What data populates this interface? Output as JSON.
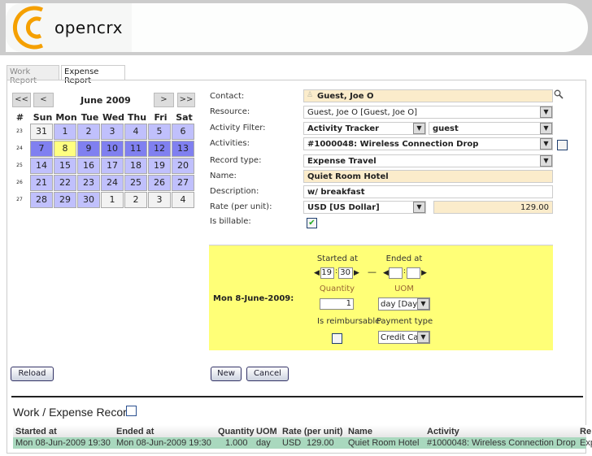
{
  "app": {
    "logo_text": "opencrx",
    "brand_color": "#f5a000"
  },
  "tabs": [
    {
      "label": "Work Report",
      "active": false
    },
    {
      "label": "Expense Report",
      "active": true
    }
  ],
  "calendar": {
    "nav": {
      "prev_year": "<<",
      "prev_month": "<",
      "next_month": ">",
      "next_year": ">>"
    },
    "month_label": "June 2009",
    "week_header": "#",
    "day_headers": [
      "Sun",
      "Mon",
      "Tue",
      "Wed",
      "Thu",
      "Fri",
      "Sat"
    ],
    "weeks": [
      {
        "num": "23",
        "days": [
          "31",
          "1",
          "2",
          "3",
          "4",
          "5",
          "6"
        ]
      },
      {
        "num": "24",
        "days": [
          "7",
          "8",
          "9",
          "10",
          "11",
          "12",
          "13"
        ]
      },
      {
        "num": "25",
        "days": [
          "14",
          "15",
          "16",
          "17",
          "18",
          "19",
          "20"
        ]
      },
      {
        "num": "26",
        "days": [
          "21",
          "22",
          "23",
          "24",
          "25",
          "26",
          "27"
        ]
      },
      {
        "num": "27",
        "days": [
          "28",
          "29",
          "30",
          "1",
          "2",
          "3",
          "4"
        ]
      }
    ],
    "selected_day": "8",
    "colors": {
      "day": "#c0c0fc",
      "selected_week": "#8080f0",
      "today": "#ffff80",
      "other_month": "#f2f2f2"
    }
  },
  "form": {
    "contact": {
      "label": "Contact:",
      "value": "Guest, Joe O"
    },
    "resource": {
      "label": "Resource:",
      "value": "Guest, Joe O [Guest, Joe O]"
    },
    "activity_filter": {
      "label": "Activity Filter:",
      "value": "Activity Tracker",
      "value2": "guest"
    },
    "activities": {
      "label": "Activities:",
      "value": "#1000048: Wireless Connection Drop"
    },
    "record_type": {
      "label": "Record type:",
      "value": "Expense Travel"
    },
    "name": {
      "label": "Name:",
      "value": "Quiet Room Hotel"
    },
    "description": {
      "label": "Description:",
      "value": "w/ breakfast"
    },
    "rate": {
      "label": "Rate (per unit):",
      "currency": "USD [US Dollar]",
      "value": "129.00"
    },
    "billable": {
      "label": "Is billable:",
      "checked": true
    }
  },
  "detail": {
    "date_label": "Mon 8-June-2009:",
    "started_label": "Started at",
    "start_hour": "19",
    "start_min": "30",
    "dash": "—",
    "ended_label": "Ended at",
    "end_hour": "",
    "end_min": "",
    "quantity_label": "Quantity",
    "quantity": "1",
    "uom_label": "UOM",
    "uom": "day [Day]",
    "reimbursable_label": "Is reimbursable",
    "payment_label": "Payment type",
    "payment": "Credit Card"
  },
  "buttons": {
    "reload": "Reload",
    "new": "New",
    "cancel": "Cancel"
  },
  "records": {
    "title": "Work / Expense Record",
    "columns": [
      "Started at",
      "Ended at",
      "Quantity",
      "UOM",
      "Rate (per unit)",
      "Name",
      "Activity",
      "Re"
    ],
    "rows": [
      {
        "started": "Mon 08-Jun-2009 19:30",
        "ended": "Mon 08-Jun-2009 19:30",
        "quantity": "1.000",
        "uom": "day",
        "currency": "USD",
        "rate": "129.00",
        "name": "Quiet Room Hotel",
        "activity": "#1000048: Wireless Connection Drop",
        "record_type": "Exp"
      }
    ]
  }
}
